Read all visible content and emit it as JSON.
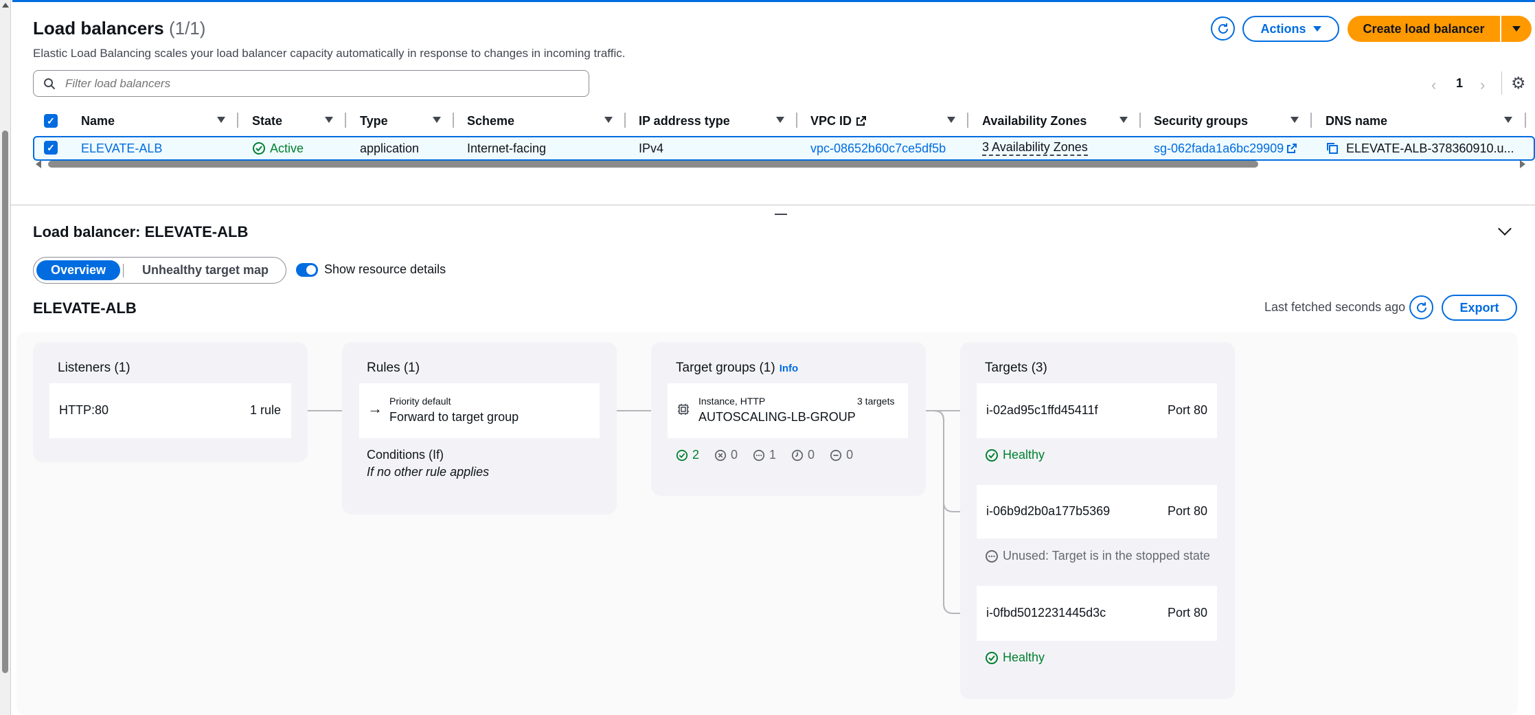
{
  "list": {
    "title": "Load balancers",
    "count": "(1/1)",
    "description": "Elastic Load Balancing scales your load balancer capacity automatically in response to changes in incoming traffic.",
    "actions_label": "Actions",
    "create_label": "Create load balancer",
    "filter_placeholder": "Filter load balancers",
    "page": "1"
  },
  "table": {
    "columns": [
      "Name",
      "State",
      "Type",
      "Scheme",
      "IP address type",
      "VPC ID",
      "Availability Zones",
      "Security groups",
      "DNS name"
    ],
    "row": {
      "name": "ELEVATE-ALB",
      "state": "Active",
      "type": "application",
      "scheme": "Internet-facing",
      "ip_type": "IPv4",
      "vpc_id": "vpc-08652b60c7ce5df5b",
      "azs": "3 Availability Zones",
      "sg": "sg-062fada1a6bc29909",
      "dns": "ELEVATE-ALB-378360910.u..."
    }
  },
  "detail": {
    "title": "Load balancer: ELEVATE-ALB",
    "tab_overview": "Overview",
    "tab_unhealthy": "Unhealthy target map",
    "toggle_label": "Show resource details",
    "lb_name": "ELEVATE-ALB",
    "last_fetched": "Last fetched seconds ago",
    "export_label": "Export"
  },
  "map": {
    "listeners": {
      "title": "Listeners (1)",
      "protocol": "HTTP:80",
      "rules": "1 rule"
    },
    "rules": {
      "title": "Rules (1)",
      "priority": "Priority default",
      "action": "Forward to target group",
      "conditions_title": "Conditions (If)",
      "conditions_text": "If no other rule applies"
    },
    "target_groups": {
      "title": "Target groups (1)",
      "info": "Info",
      "kind": "Instance, HTTP",
      "count": "3 targets",
      "name": "AUTOSCALING-LB-GROUP",
      "stats": {
        "healthy": "2",
        "unhealthy": "0",
        "unused": "1",
        "initial": "0",
        "draining": "0"
      }
    },
    "targets": {
      "title": "Targets (3)",
      "items": [
        {
          "id": "i-02ad95c1ffd45411f",
          "port": "Port 80",
          "status": "Healthy"
        },
        {
          "id": "i-06b9d2b0a177b5369",
          "port": "Port 80",
          "status": "Unused: Target is in the stopped state"
        },
        {
          "id": "i-0fbd5012231445d3c",
          "port": "Port 80",
          "status": "Healthy"
        }
      ]
    }
  },
  "colors": {
    "accent": "#006ce0",
    "primary_button": "#ff9900",
    "healthy": "#00802f"
  }
}
